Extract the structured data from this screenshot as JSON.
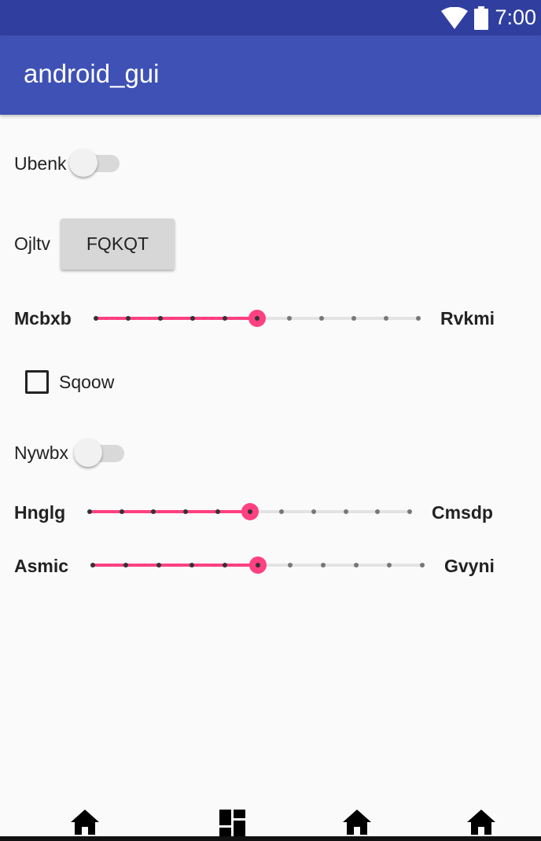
{
  "status_bar": {
    "time": "7:00",
    "icons": [
      "wifi-icon",
      "battery-icon"
    ],
    "color": "#303f9f"
  },
  "app_bar": {
    "title": "android_gui",
    "color": "#3f51b5"
  },
  "accent_color": "#ff4081",
  "controls": {
    "switch1": {
      "label": "Ubenk",
      "checked": false
    },
    "button_row": {
      "label": "Ojltv",
      "button_text": "FQKQT"
    },
    "slider1": {
      "left_label": "Mcbxb",
      "right_label": "Rvkmi",
      "steps": 10,
      "value": 5
    },
    "checkbox1": {
      "label": "Sqoow",
      "checked": false
    },
    "switch2": {
      "label": "Nywbx",
      "checked": false
    },
    "slider2": {
      "left_label": "Hnglg",
      "right_label": "Cmsdp",
      "steps": 10,
      "value": 5
    },
    "slider3": {
      "left_label": "Asmic",
      "right_label": "Gvyni",
      "steps": 10,
      "value": 5
    }
  },
  "bottom_nav": {
    "items": [
      "home-icon",
      "dashboard-icon",
      "home-icon",
      "home-icon"
    ]
  }
}
